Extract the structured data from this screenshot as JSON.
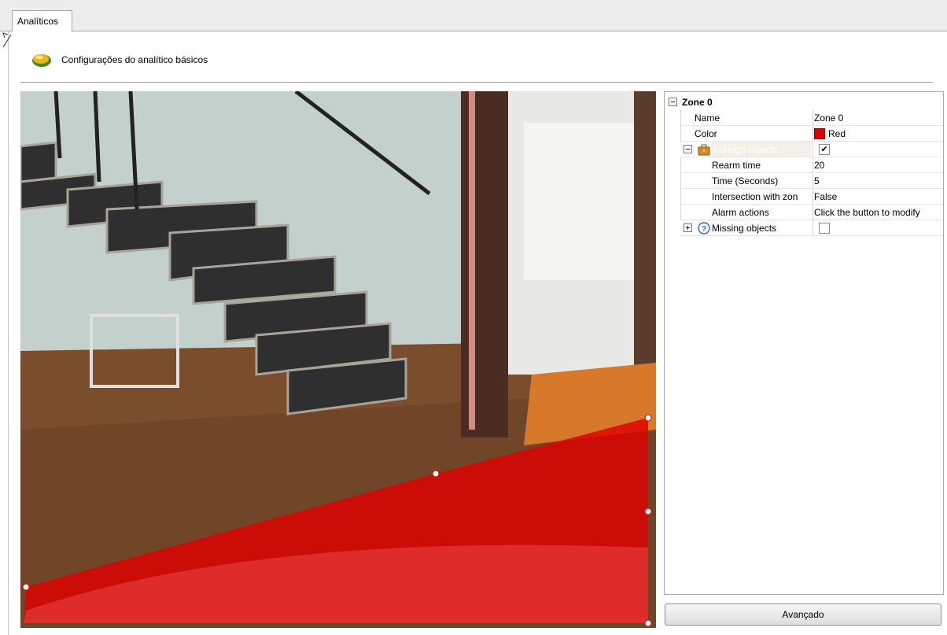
{
  "tabs": [
    {
      "label": "Analíticos",
      "active": true
    }
  ],
  "section": {
    "title": "Configurações do analítico básicos",
    "icon": "analytics-disc-icon"
  },
  "property_grid": {
    "group": {
      "label": "Zone 0",
      "expanded": true
    },
    "rows": [
      {
        "name": "Name",
        "value": "Zone 0"
      },
      {
        "name": "Color",
        "value": "Red",
        "swatch": "#e00000"
      },
      {
        "name": "Foreign objects",
        "checked": true,
        "icon": "briefcase-icon",
        "selected": true
      },
      {
        "name": "Rearm time",
        "value": "20"
      },
      {
        "name": "Time (Seconds)",
        "value": "5"
      },
      {
        "name": "Intersection with zon",
        "value": "False"
      },
      {
        "name": "Alarm actions",
        "value": "Click the button to modify"
      },
      {
        "name": "Missing objects",
        "checked": false,
        "icon": "help-circle-icon",
        "expanded": false
      }
    ]
  },
  "buttons": {
    "advanced": "Avançado"
  },
  "zone_overlay": {
    "color": "#e00000"
  }
}
